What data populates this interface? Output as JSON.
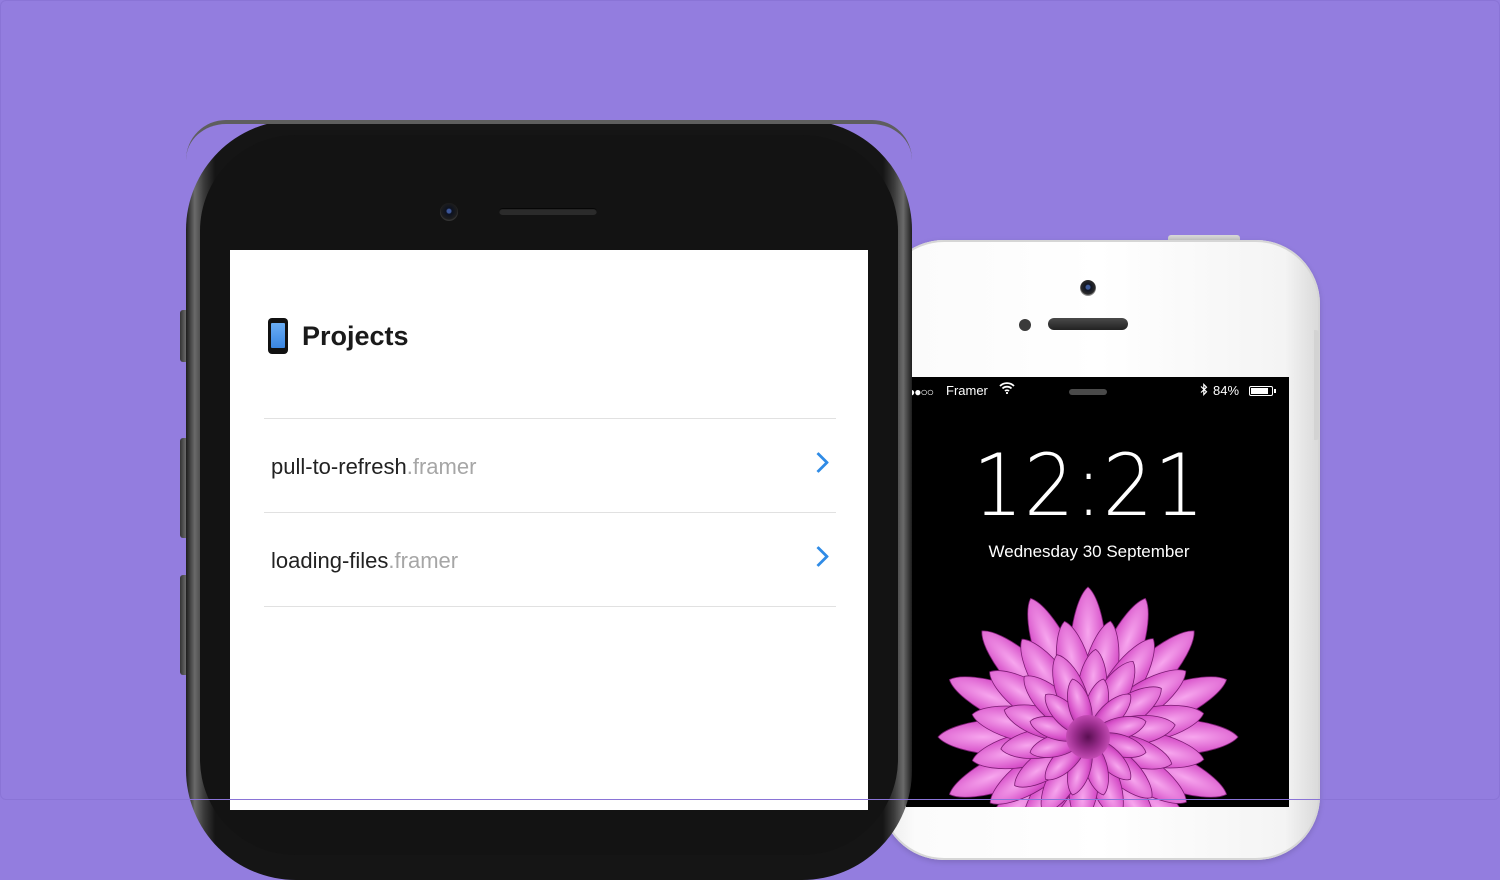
{
  "colors": {
    "background": "#937ddf",
    "accent": "#2f8be6",
    "extension_gray": "#a6a6a6"
  },
  "front_device": {
    "screen": {
      "header": {
        "icon": "mobile-phone-icon",
        "title": "Projects"
      },
      "projects": [
        {
          "name": "pull-to-refresh",
          "extension": ".framer",
          "icon": "chevron-right-icon"
        },
        {
          "name": "loading-files",
          "extension": ".framer",
          "icon": "chevron-right-icon"
        }
      ]
    }
  },
  "back_device": {
    "status_bar": {
      "signal": "●●○○",
      "carrier": "Framer",
      "wifi_icon": "wifi-icon",
      "bluetooth_icon": "bluetooth-icon",
      "battery": "84%",
      "battery_level": 0.84
    },
    "lock_screen": {
      "time": "12:21",
      "date": "Wednesday 30 September",
      "wallpaper": "pink-dahlia-flower"
    }
  }
}
